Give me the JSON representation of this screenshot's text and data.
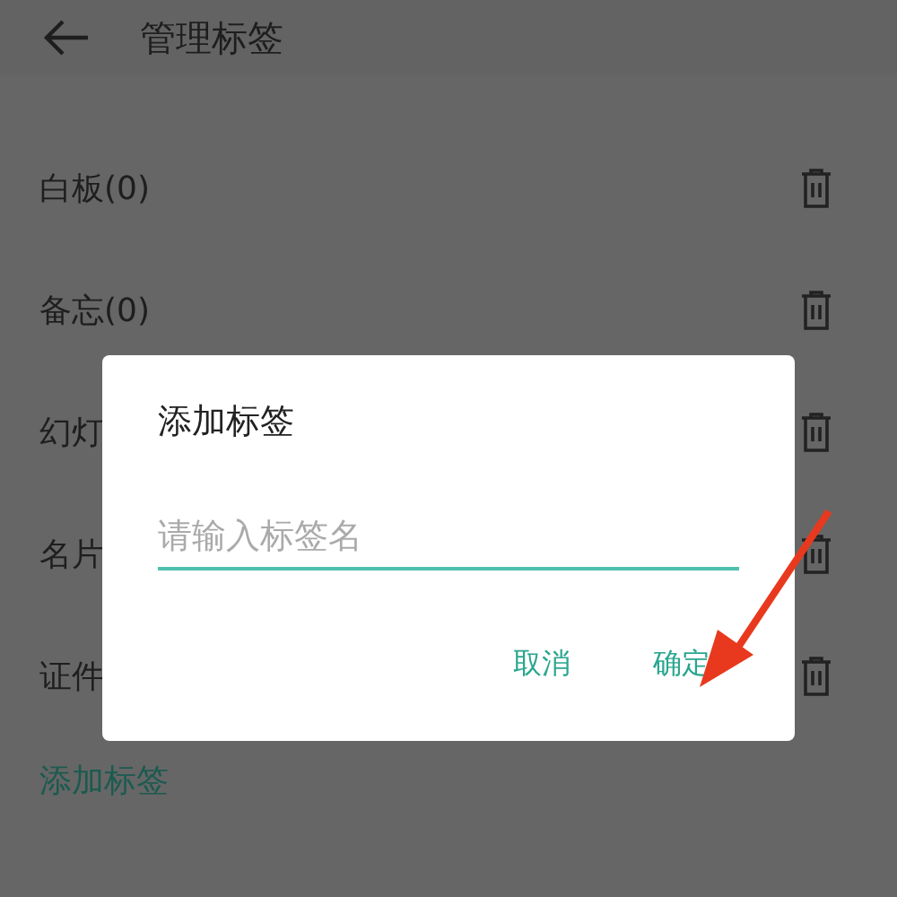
{
  "header": {
    "title": "管理标签"
  },
  "tags": [
    {
      "label": "白板(0)"
    },
    {
      "label": "备忘(0)"
    },
    {
      "label": "幻灯"
    },
    {
      "label": "名片"
    },
    {
      "label": "证件"
    }
  ],
  "add_link": "添加标签",
  "dialog": {
    "title": "添加标签",
    "input": {
      "placeholder": "请输入标签名"
    },
    "buttons": [
      "取消",
      "确定"
    ]
  }
}
